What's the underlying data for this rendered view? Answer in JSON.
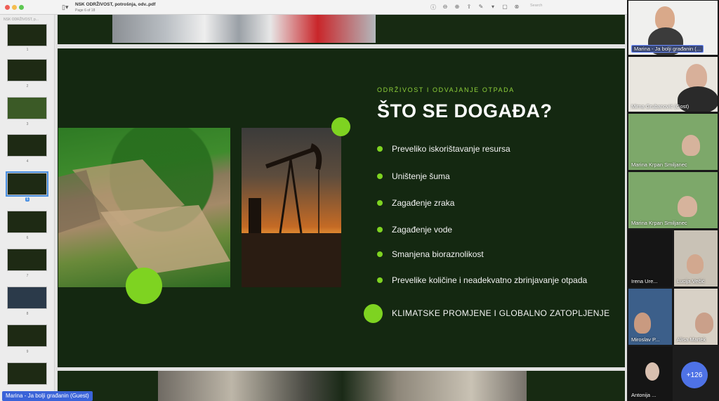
{
  "window": {
    "doc_title": "NSK ODRŽIVOST, potrošnja, odv..pdf",
    "page_info": "Page 6 of 18",
    "search_placeholder": "Search",
    "sidebar_header": "NSK ODRŽIVOST, p..."
  },
  "toolbar": {
    "icons": [
      "info-icon",
      "zoom-out-icon",
      "zoom-in-icon",
      "share-icon",
      "markup-icon",
      "rotate-icon",
      "crop-icon"
    ]
  },
  "thumbnails": [
    {
      "num": "1",
      "selected": false
    },
    {
      "num": "2",
      "selected": false
    },
    {
      "num": "3",
      "selected": false
    },
    {
      "num": "4",
      "selected": false
    },
    {
      "num": "5",
      "selected": true
    },
    {
      "num": "6",
      "selected": false
    },
    {
      "num": "7",
      "selected": false
    },
    {
      "num": "8",
      "selected": false
    },
    {
      "num": "9",
      "selected": false
    }
  ],
  "slide": {
    "kicker": "ODRŽIVOST I ODVAJANJE OTPADA",
    "title": "ŠTO SE DOGAĐA?",
    "bullets": [
      "Preveliko iskorištavanje resursa",
      "Uništenje šuma",
      "Zagađenje zraka",
      "Zagađenje vode",
      "Smanjena bioraznolikost",
      "Prevelike količine i neadekvatno zbrinjavanje otpada"
    ],
    "highlight": "KLIMATSKE PROMJENE I GLOBALNO ZATOPLJENJE"
  },
  "guest_label": "Marina - Ja bolji građanin (Guest)",
  "participants": [
    {
      "name": "Marina - Ja bolji građanin (..."
    },
    {
      "name": "Mirna Grubanović (Gost)"
    },
    {
      "name": "Marina Krpan Smiljanec"
    },
    {
      "name": "Marina Krpan Smiljanec"
    },
    {
      "name": "Irena Ure..."
    },
    {
      "name": "Lucija Večić"
    },
    {
      "name": "Miroslav P..."
    },
    {
      "name": "Alisa Martek"
    },
    {
      "name": "Antonija ..."
    }
  ],
  "more_participants": "+126",
  "colors": {
    "slide_bg": "#142811",
    "accent_green": "#7ed321",
    "guest_blue": "#3a63d8"
  }
}
